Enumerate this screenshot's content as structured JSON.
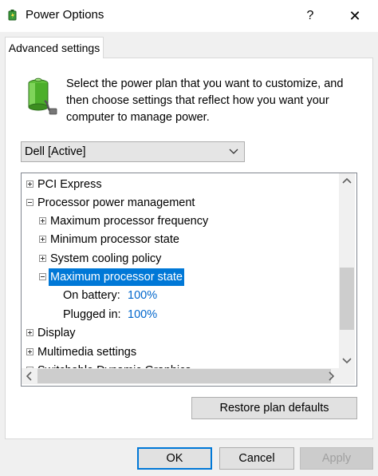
{
  "window": {
    "title": "Power Options",
    "help_glyph": "?",
    "close_glyph": "✕"
  },
  "tabs": [
    {
      "label": "Advanced settings",
      "active": true
    }
  ],
  "intro": {
    "text": "Select the power plan that you want to customize, and then choose settings that reflect how you want your computer to manage power."
  },
  "plan_select": {
    "value": "Dell [Active]"
  },
  "tree": {
    "rows": [
      {
        "label": "PCI Express",
        "expanded": false
      },
      {
        "label": "Processor power management",
        "expanded": true
      },
      {
        "label": "Maximum processor frequency",
        "expanded": false
      },
      {
        "label": "Minimum processor state",
        "expanded": false
      },
      {
        "label": "System cooling policy",
        "expanded": false
      },
      {
        "label": "Maximum processor state",
        "expanded": true,
        "selected": true
      },
      {
        "label": "On battery:",
        "value": "100%"
      },
      {
        "label": "Plugged in:",
        "value": "100%"
      },
      {
        "label": "Display",
        "expanded": false
      },
      {
        "label": "Multimedia settings",
        "expanded": false
      },
      {
        "label": "Switchable Dynamic Graphics",
        "expanded": false
      }
    ]
  },
  "buttons": {
    "restore": "Restore plan defaults",
    "ok": "OK",
    "cancel": "Cancel",
    "apply": "Apply"
  },
  "colors": {
    "selection": "#0078d7",
    "value_link": "#0066cc",
    "dialog_bg": "#f0f0f0"
  }
}
